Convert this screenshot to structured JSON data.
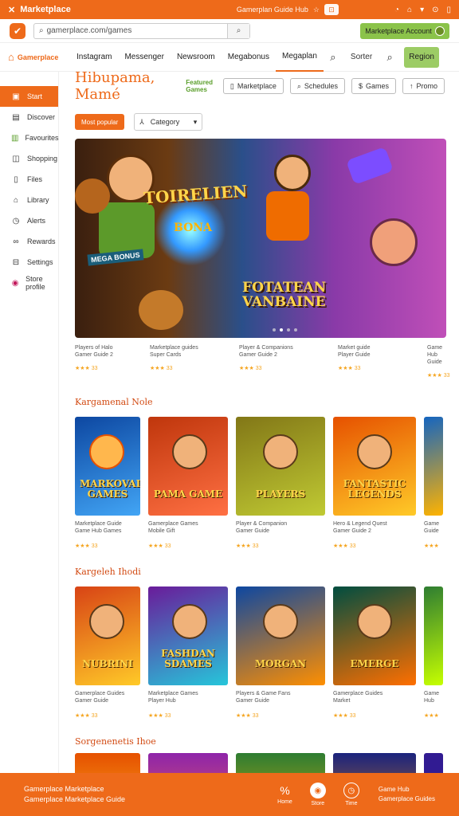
{
  "titlebar": {
    "app_name": "Marketplace",
    "center_text": "Gamerplan Guide Hub",
    "controls": [
      "◔",
      "⌂",
      "▾",
      "⊙",
      "▯"
    ]
  },
  "address": {
    "url": "gamerplace.com/games",
    "account_label": "Marketplace Account"
  },
  "topnav": {
    "brand": "Gamerplace",
    "items": [
      "Instagram",
      "Messenger",
      "Newsroom",
      "Megabonus",
      "Megaplan"
    ],
    "active_index": 4,
    "sort_label": "Sorter",
    "cta_label": "Region"
  },
  "sidebar": {
    "items": [
      {
        "label": "Start",
        "icon": "home-icon"
      },
      {
        "label": "Discover",
        "icon": "grid-icon"
      },
      {
        "label": "Favourites",
        "icon": "chart-icon"
      },
      {
        "label": "Shopping",
        "icon": "bag-icon"
      },
      {
        "label": "Files",
        "icon": "file-icon"
      },
      {
        "label": "Library",
        "icon": "folder-icon"
      },
      {
        "label": "Alerts",
        "icon": "clock-icon"
      },
      {
        "label": "Rewards",
        "icon": "link-icon"
      },
      {
        "label": "Settings",
        "icon": "gear-icon"
      },
      {
        "label": "Store profile",
        "icon": "profile-icon"
      }
    ],
    "active_index": 0
  },
  "page": {
    "title": "Hibupama, Mamé",
    "badge": "Featured Games",
    "buttons": [
      "Marketplace",
      "Schedules",
      "Games",
      "Promo"
    ]
  },
  "filters": {
    "chip": "Most popular",
    "select_label": "Category"
  },
  "hero": {
    "title1": "TOIRELIEN",
    "title2": "FOTATEAN VANBAINE",
    "tag": "MEGA BONUS",
    "orb_text": "BONA",
    "slide_count": 4,
    "active_slide": 1
  },
  "hero_cards": [
    {
      "line1": "Players of Halo",
      "line2": "Gamer Guide 2",
      "rating": "33"
    },
    {
      "line1": "Marketplace guides",
      "line2": "Super Cards",
      "rating": "33"
    },
    {
      "line1": "Player & Companions",
      "line2": "Gamer Guide 2",
      "rating": "33"
    },
    {
      "line1": "Market guide",
      "line2": "Player Guide",
      "rating": "33"
    },
    {
      "line1": "Game Hub",
      "line2": "Guide",
      "rating": "33"
    }
  ],
  "section1": {
    "title": "Kargamenal Nole",
    "tiles": [
      {
        "label": "MARKOVAIS GAMES",
        "line1": "Marketplace Guide",
        "line2": "Game Hub Games",
        "rating": "33",
        "bg": "#1d6fd6"
      },
      {
        "label": "PAMA GAME",
        "line1": "Gamerplace Games",
        "line2": "Mobile Gift",
        "rating": "33",
        "bg": "#d8471e"
      },
      {
        "label": "PLAYERS",
        "line1": "Player & Companion",
        "line2": "Gamer Guide",
        "rating": "33",
        "bg": "#6a8f1e"
      },
      {
        "label": "FANTASTIC LEGENDS",
        "line1": "Hero & Legend Quest",
        "line2": "Gamer Guide 2",
        "rating": "33",
        "bg": "#ea7d2d"
      },
      {
        "label": "",
        "line1": "Game",
        "line2": "Guide",
        "rating": "33",
        "bg": "#2a7bbf"
      }
    ]
  },
  "section2": {
    "title": "Kargeleh Ihodi",
    "tiles": [
      {
        "label": "NUBRINI",
        "line1": "Gamerplace Guides",
        "line2": "Gamer Guide",
        "rating": "33",
        "bg": "#e64a19"
      },
      {
        "label": "FASHDAN SDAMES",
        "line1": "Marketplace Games",
        "line2": "Player Hub",
        "rating": "33",
        "bg": "#7b3bc2"
      },
      {
        "label": "MORGAN",
        "line1": "Players & Game Fans",
        "line2": "Gamer Guide",
        "rating": "33",
        "bg": "#1f6fb2"
      },
      {
        "label": "EMERGE",
        "line1": "Gamerplace Guides",
        "line2": "Market",
        "rating": "33",
        "bg": "#0f5e5a"
      },
      {
        "label": "",
        "line1": "Game",
        "line2": "Hub",
        "rating": "33",
        "bg": "#3d9b3a"
      }
    ]
  },
  "section3": {
    "title": "Sorgenenetis Ihoe"
  },
  "footer": {
    "line1": "Gamerplace Marketplace",
    "line2": "Gamerplace Marketplace Guide",
    "icons": [
      {
        "label": "Home",
        "glyph": "%"
      },
      {
        "label": "Store",
        "glyph": "◉"
      },
      {
        "label": "Time",
        "glyph": "◷"
      }
    ],
    "right1": "Game Hub",
    "right2": "Gamerplace Guides"
  },
  "colors": {
    "accent": "#ee6a1a",
    "green": "#8bc34a",
    "star": "#f5a623"
  }
}
